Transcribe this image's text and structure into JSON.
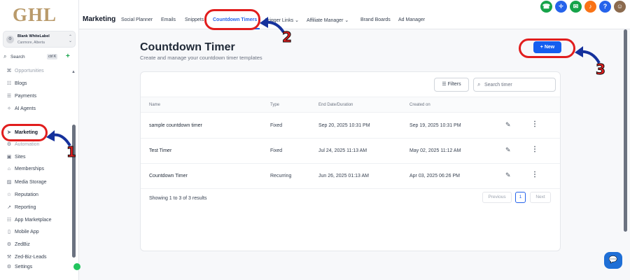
{
  "sidebar": {
    "logo": "GHL",
    "account": {
      "avatar": "⚙",
      "name": "Blank WhiteLabel",
      "location": "Canmore, Alberta"
    },
    "search": {
      "label": "Search",
      "shortcut": "ctrl K"
    },
    "items": [
      {
        "label": "Opportunities",
        "icon": "opportunities-icon",
        "glyph": "⌘"
      },
      {
        "label": "Blogs",
        "icon": "blogs-icon",
        "glyph": "☷"
      },
      {
        "label": "Payments",
        "icon": "payments-icon",
        "glyph": "☰"
      },
      {
        "label": "AI Agents",
        "icon": "ai-agents-icon",
        "glyph": "✧"
      },
      {
        "label": "Marketing",
        "icon": "marketing-icon",
        "glyph": "➤"
      },
      {
        "label": "Automation",
        "icon": "automation-icon",
        "glyph": "⚙"
      },
      {
        "label": "Sites",
        "icon": "sites-icon",
        "glyph": "▣"
      },
      {
        "label": "Memberships",
        "icon": "memberships-icon",
        "glyph": "⌂"
      },
      {
        "label": "Media Storage",
        "icon": "media-storage-icon",
        "glyph": "▨"
      },
      {
        "label": "Reputation",
        "icon": "reputation-icon",
        "glyph": "☆"
      },
      {
        "label": "Reporting",
        "icon": "reporting-icon",
        "glyph": "↗"
      },
      {
        "label": "App Marketplace",
        "icon": "app-marketplace-icon",
        "glyph": "☷"
      },
      {
        "label": "Mobile App",
        "icon": "mobile-app-icon",
        "glyph": "▯"
      },
      {
        "label": "ZedBiz",
        "icon": "zedbiz-icon",
        "glyph": "⚙"
      },
      {
        "label": "Zed-Biz-Leads",
        "icon": "zed-biz-leads-icon",
        "glyph": "⚒"
      },
      {
        "label": "Settings",
        "icon": "settings-icon",
        "glyph": "⚙"
      }
    ]
  },
  "topbar": {
    "title": "Marketing",
    "tabs": [
      {
        "label": "Social Planner"
      },
      {
        "label": "Emails"
      },
      {
        "label": "Snippets"
      },
      {
        "label": "Countdown Timers"
      },
      {
        "label": "Trigger Links ⌄"
      },
      {
        "label": "Affiliate Manager ⌄"
      },
      {
        "label": "Brand Boards"
      },
      {
        "label": "Ad Manager"
      }
    ],
    "icons": [
      {
        "name": "phone-icon",
        "glyph": "☎",
        "color": "#16a34a"
      },
      {
        "name": "magic-icon",
        "glyph": "✧",
        "color": "#2563eb"
      },
      {
        "name": "megaphone-icon",
        "glyph": "✉",
        "color": "#16a34a"
      },
      {
        "name": "bell-icon",
        "glyph": "♪",
        "color": "#f97316"
      },
      {
        "name": "help-icon",
        "glyph": "?",
        "color": "#2563eb"
      },
      {
        "name": "user-avatar-icon",
        "glyph": "☺",
        "color": "#8b6a4e"
      }
    ]
  },
  "page": {
    "title": "Countdown Timer",
    "subtitle": "Create and manage your countdown timer templates",
    "new_button": "+ New"
  },
  "table": {
    "filters_label": "Filters",
    "search_placeholder": "Search timer",
    "columns": [
      "Name",
      "Type",
      "End Date/Duration",
      "Created on"
    ],
    "rows": [
      {
        "name": "sample countdown timer",
        "type": "Fixed",
        "end": "Sep 20, 2025 10:31 PM",
        "created": "Sep 19, 2025 10:31 PM"
      },
      {
        "name": "Test Timer",
        "type": "Fixed",
        "end": "Jul 24, 2025 11:13 AM",
        "created": "May 02, 2025 11:12 AM"
      },
      {
        "name": "Countdown Timer",
        "type": "Recurring",
        "end": "Jun 26, 2025 01:13 AM",
        "created": "Apr 03, 2025 06:26 PM"
      }
    ],
    "footer": "Showing 1 to 3 of 3 results",
    "pagination": {
      "previous": "Previous",
      "current": "1",
      "next": "Next"
    }
  },
  "annotations": {
    "step1": "1",
    "step2": "2",
    "step3": "3"
  },
  "colors": {
    "accent": "#155eef",
    "annotation": "#e11d1d",
    "logo": "#b99a6a"
  }
}
